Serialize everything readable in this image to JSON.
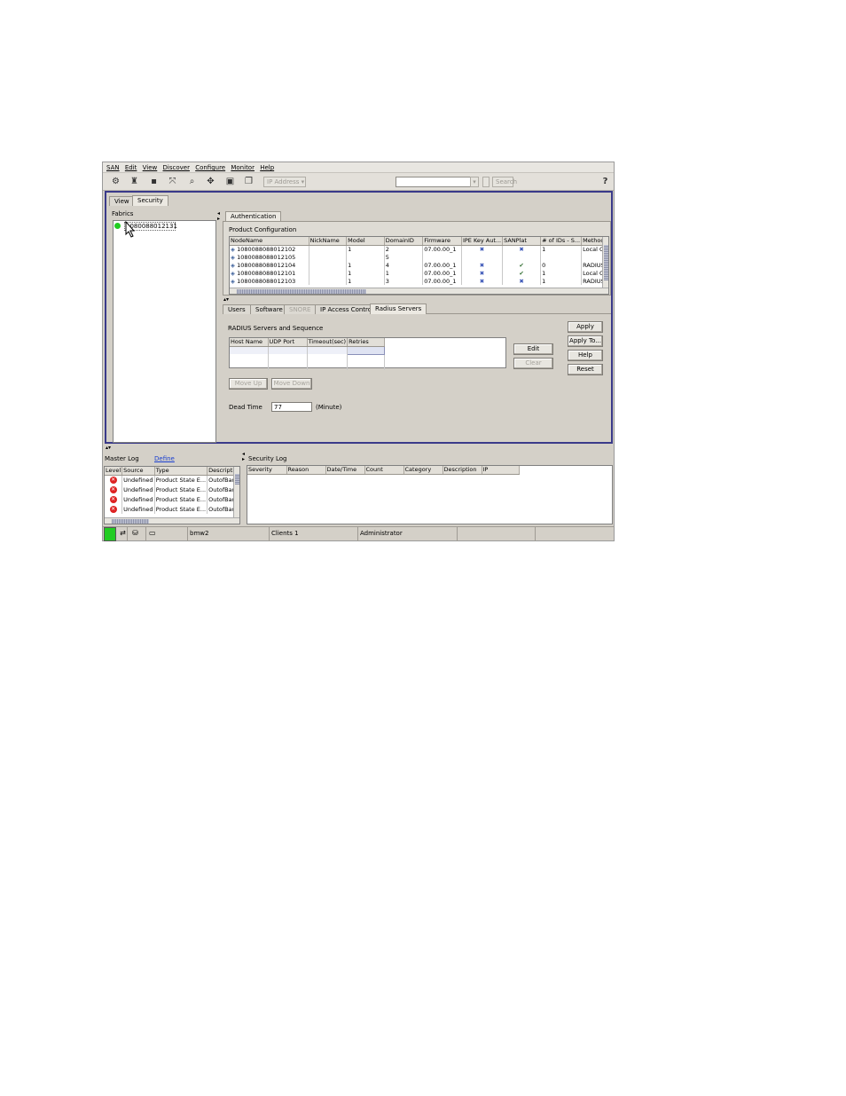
{
  "menu": [
    "SAN",
    "Edit",
    "View",
    "Discover",
    "Configure",
    "Monitor",
    "Help"
  ],
  "toolbar": {
    "ip_dropdown": "IP Address",
    "search_button": "Search",
    "help_glyph": "?"
  },
  "main_tabs": [
    "View",
    "Security"
  ],
  "fabrics": {
    "title": "Fabrics",
    "item": "1080088012131"
  },
  "auth_tab": "Authentication",
  "product_config": {
    "title": "Product Configuration",
    "columns": [
      "NodeName",
      "NickName",
      "Model",
      "DomainID",
      "Firmware",
      "IPE Key Aut...",
      "SANPlat",
      "# of IDs - S...",
      "Method"
    ],
    "rows": [
      {
        "node": "1080088088012102",
        "nick": "",
        "model": "1",
        "domain": "2",
        "fw": "07.00.00_1",
        "key": "x",
        "san": "x",
        "ids": "1",
        "method": "Local O"
      },
      {
        "node": "1080088088012105",
        "nick": "",
        "model": "",
        "domain": "5",
        "fw": "",
        "key": "",
        "san": "",
        "ids": "",
        "method": ""
      },
      {
        "node": "1080088088012104",
        "nick": "",
        "model": "1",
        "domain": "4",
        "fw": "07.00.00_1",
        "key": "x",
        "san": "check",
        "ids": "0",
        "method": "RADIUS"
      },
      {
        "node": "1080088088012101",
        "nick": "",
        "model": "1",
        "domain": "1",
        "fw": "07.00.00_1",
        "key": "x",
        "san": "check",
        "ids": "1",
        "method": "Local O"
      },
      {
        "node": "1080088088012103",
        "nick": "",
        "model": "1",
        "domain": "3",
        "fw": "07.00.00_1",
        "key": "x",
        "san": "x",
        "ids": "1",
        "method": "RADIUS"
      }
    ]
  },
  "sub_tabs": [
    "Users",
    "Software",
    "SNORE",
    "IP Access Control",
    "Radius Servers"
  ],
  "radius": {
    "title": "RADIUS Servers and Sequence",
    "columns": [
      "Host Name",
      "UDP Port",
      "Timeout(sec)",
      "Retries"
    ],
    "edit": "Edit",
    "clear": "Clear",
    "move_up": "Move Up",
    "move_down": "Move Down",
    "dead_time_label": "Dead Time",
    "dead_time_value": "77",
    "dead_time_unit": "(Minute)"
  },
  "actions": [
    "Apply",
    "Apply To...",
    "Help",
    "Reset"
  ],
  "master_log": {
    "title": "Master Log",
    "define": "Define",
    "columns": [
      "Level",
      "Source",
      "Type",
      "Descriptio"
    ],
    "rows": [
      {
        "source": "Undefined",
        "type": "Product State E...",
        "desc": "OutofBan"
      },
      {
        "source": "Undefined",
        "type": "Product State E...",
        "desc": "OutofBan"
      },
      {
        "source": "Undefined",
        "type": "Product State E...",
        "desc": "OutofBan"
      },
      {
        "source": "Undefined",
        "type": "Product State E...",
        "desc": "OutofBan"
      }
    ]
  },
  "security_log": {
    "title": "Security Log",
    "columns": [
      "Severity",
      "Reason",
      "Date/Time",
      "Count",
      "Category",
      "Description",
      "IP"
    ]
  },
  "status": {
    "server": "bmw2",
    "clients": "Clients  1",
    "user": "Administrator"
  },
  "colors": {
    "frame_border": "#3a3a8a",
    "fabric_dot": "#22cc22",
    "error": "#d22222",
    "link": "#1a3fd0"
  }
}
